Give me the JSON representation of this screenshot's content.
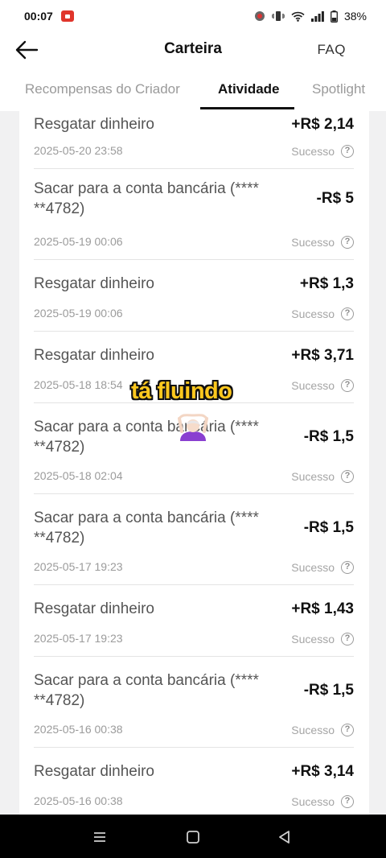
{
  "status_bar": {
    "time": "00:07",
    "battery": "38%",
    "icons": [
      "record-icon",
      "vibrate-icon",
      "wifi-icon",
      "signal-icon",
      "battery-icon"
    ]
  },
  "header": {
    "title": "Carteira",
    "faq_label": "FAQ",
    "back_icon": "arrow-left-icon"
  },
  "tabs": [
    {
      "label": "Recompensas do Criador",
      "active": false
    },
    {
      "label": "Atividade",
      "active": true
    },
    {
      "label": "Spotlight",
      "active": false
    }
  ],
  "transactions": [
    {
      "description": "Resgatar dinheiro",
      "amount": "+R$ 2,14",
      "date": "2025-05-20 23:58",
      "status": "Sucesso"
    },
    {
      "description": "Sacar para a conta bancária (**** **4782)",
      "amount": "-R$ 5",
      "date": "2025-05-19 00:06",
      "status": "Sucesso"
    },
    {
      "description": "Resgatar dinheiro",
      "amount": "+R$ 1,3",
      "date": "2025-05-19 00:06",
      "status": "Sucesso"
    },
    {
      "description": "Resgatar dinheiro",
      "amount": "+R$ 3,71",
      "date": "2025-05-18 18:54",
      "status": "Sucesso"
    },
    {
      "description": "Sacar para a conta bancária (**** **4782)",
      "amount": "-R$ 1,5",
      "date": "2025-05-18 02:04",
      "status": "Sucesso"
    },
    {
      "description": "Sacar para a conta bancária (**** **4782)",
      "amount": "-R$ 1,5",
      "date": "2025-05-17 19:23",
      "status": "Sucesso"
    },
    {
      "description": "Resgatar dinheiro",
      "amount": "+R$ 1,43",
      "date": "2025-05-17 19:23",
      "status": "Sucesso"
    },
    {
      "description": "Sacar para a conta bancária (**** **4782)",
      "amount": "-R$ 1,5",
      "date": "2025-05-16 00:38",
      "status": "Sucesso"
    },
    {
      "description": "Resgatar dinheiro",
      "amount": "+R$ 3,14",
      "date": "2025-05-16 00:38",
      "status": "Sucesso"
    }
  ],
  "overlay": {
    "caption": "tá fluindo",
    "emoji": "🙆🏻‍♀️"
  },
  "navbar": {
    "icons": [
      "recent-apps-icon",
      "home-icon",
      "back-triangle-icon"
    ]
  },
  "colors": {
    "background": "#f1f1f2",
    "caption_fill": "#ffc81e",
    "record_badge": "#e0352b"
  }
}
